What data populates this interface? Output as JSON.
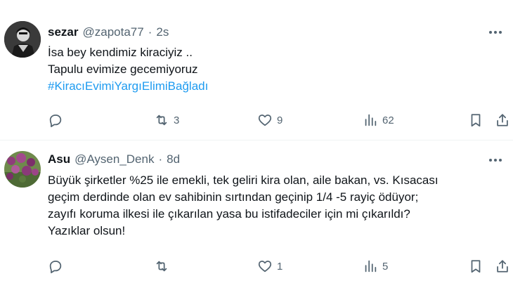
{
  "tweets": [
    {
      "name": "sezar",
      "handle": "@zapota77",
      "separator": "·",
      "time": "2s",
      "lines": [
        "İsa bey kendimiz kiraciyiz ..",
        "Tapulu evimize gecemiyoruz"
      ],
      "hashtag": "#KiracıEvimiYargıElimiBağladı",
      "replies": "",
      "retweets": "3",
      "likes": "9",
      "views": "62",
      "avatar_icon": "person-dark-avatar"
    },
    {
      "name": "Asu",
      "handle": "@Aysen_Denk",
      "separator": "·",
      "time": "8d",
      "lines": [
        "Büyük şirketler  %25 ile emekli, tek geliri kira olan, aile bakan, vs. Kısacası",
        "geçim derdinde olan ev sahibinin sırtından geçinip 1/4 -5 rayiç ödüyor;",
        "zayıfı koruma ilkesi ile çıkarılan yasa bu istifadeciler için mi çıkarıldı?",
        "Yazıklar olsun!"
      ],
      "replies": "",
      "retweets": "",
      "likes": "1",
      "views": "5",
      "avatar_icon": "flowers-avatar"
    }
  ],
  "icons": {
    "more": "more-horizontal-icon",
    "reply": "reply-icon",
    "retweet": "retweet-icon",
    "like": "heart-icon",
    "views": "views-chart-icon",
    "bookmark": "bookmark-icon",
    "share": "share-icon"
  },
  "colors": {
    "text": "#0f1419",
    "secondary": "#536471",
    "link": "#1d9bf0",
    "divider": "#eff3f4"
  }
}
